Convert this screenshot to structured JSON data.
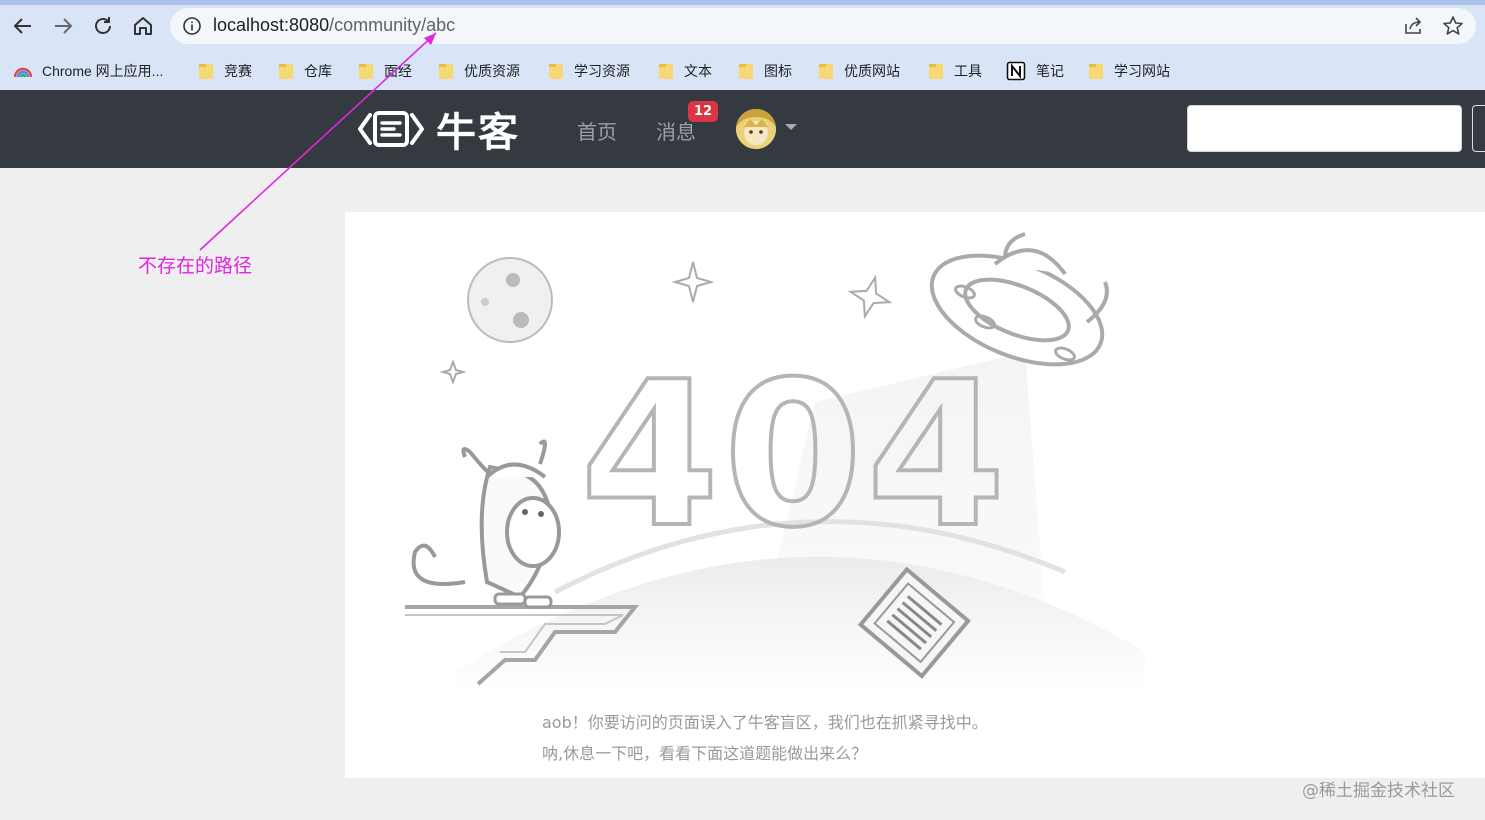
{
  "browser": {
    "url_host": "localhost:8080",
    "url_path": "/community/abc",
    "bookmarks": [
      {
        "label": "Chrome 网上应用..."
      },
      {
        "label": "竞赛"
      },
      {
        "label": "仓库"
      },
      {
        "label": "面经"
      },
      {
        "label": "优质资源"
      },
      {
        "label": "学习资源"
      },
      {
        "label": "文本"
      },
      {
        "label": "图标"
      },
      {
        "label": "优质网站"
      },
      {
        "label": "工具"
      },
      {
        "label": "笔记"
      },
      {
        "label": "学习网站"
      }
    ]
  },
  "header": {
    "logo_text": "牛客",
    "nav": [
      {
        "label": "首页"
      },
      {
        "label": "消息"
      }
    ],
    "message_badge": "12",
    "search_placeholder": ""
  },
  "error": {
    "code": "404",
    "line1": "aob！你要访问的页面误入了牛客盲区，我们也在抓紧寻找中。",
    "line2": "呐,休息一下吧，看看下面这道题能做出来么？"
  },
  "annotation": {
    "label": "不存在的路径",
    "color": "#e026e0"
  },
  "watermark": "@稀土掘金技术社区"
}
